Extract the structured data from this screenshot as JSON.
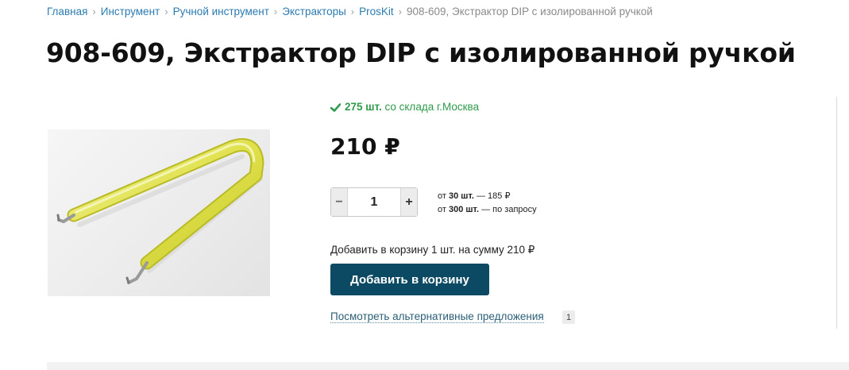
{
  "breadcrumb": {
    "items": [
      "Главная",
      "Инструмент",
      "Ручной инструмент",
      "Экстракторы",
      "ProsKit"
    ],
    "separator": "›",
    "current": "908-609, Экстрактор DIP с изолированной ручкой"
  },
  "product": {
    "title": "908-609, Экстрактор DIP с изолированной ручкой",
    "image_icon": "dip-extractor-image",
    "stock": {
      "icon": "check-icon",
      "quantity": "275 шт.",
      "location": "со склада г.Москва",
      "color": "#2f9a4b"
    },
    "price": "210 ₽",
    "quantity": {
      "minus_label": "−",
      "value": "1",
      "plus_label": "+"
    },
    "price_tiers": [
      {
        "prefix": "от",
        "qty": "30 шт.",
        "suffix": "— 185 ₽"
      },
      {
        "prefix": "от",
        "qty": "300 шт.",
        "suffix": "— по запросу"
      }
    ],
    "cart_summary": "Добавить в корзину 1 шт. на сумму 210 ₽",
    "add_to_cart_label": "Добавить в корзину",
    "alternatives_label": "Посмотреть альтернативные предложения",
    "alternatives_count": "1"
  },
  "colors": {
    "link": "#2b7bb0",
    "button": "#0c4a63",
    "stock_green": "#2f9a4b"
  }
}
